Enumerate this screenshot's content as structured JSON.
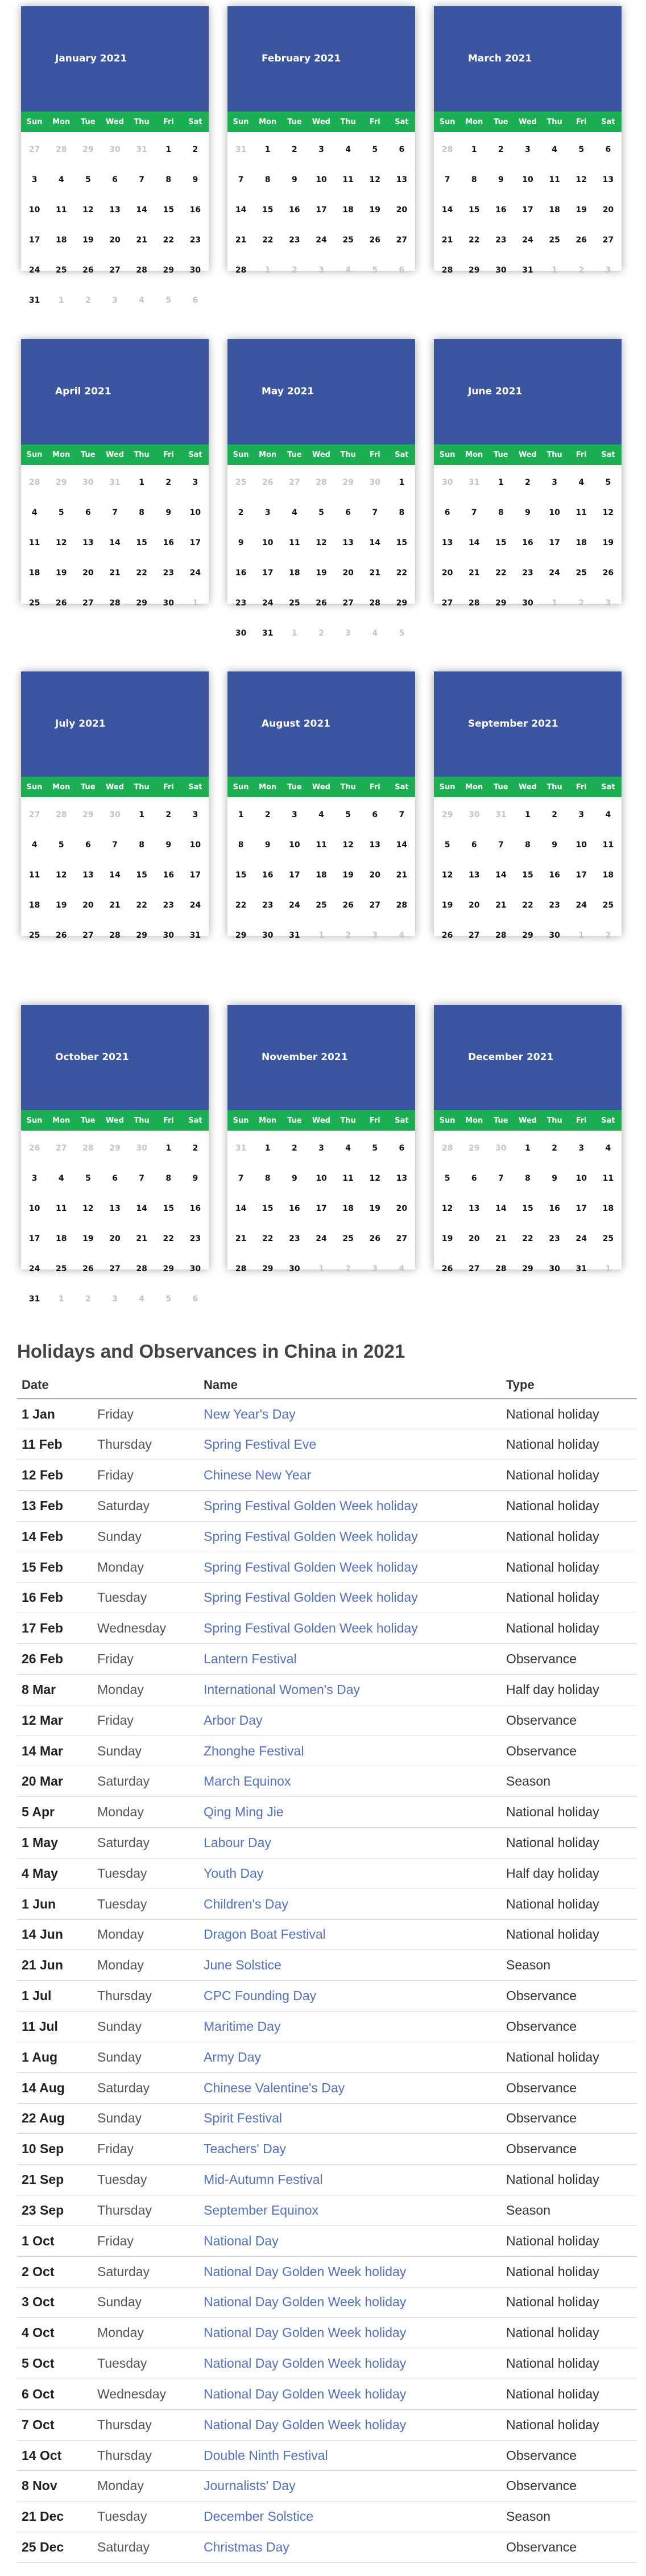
{
  "weekdays": [
    "Sun",
    "Mon",
    "Tue",
    "Wed",
    "Thu",
    "Fri",
    "Sat"
  ],
  "months": [
    {
      "title": "January 2021",
      "start": 5,
      "days": 31,
      "prev_days": 31
    },
    {
      "title": "February 2021",
      "start": 1,
      "days": 28,
      "prev_days": 31
    },
    {
      "title": "March 2021",
      "start": 1,
      "days": 31,
      "prev_days": 28
    },
    {
      "title": "April 2021",
      "start": 4,
      "days": 30,
      "prev_days": 31
    },
    {
      "title": "May 2021",
      "start": 6,
      "days": 31,
      "prev_days": 30
    },
    {
      "title": "June 2021",
      "start": 2,
      "days": 30,
      "prev_days": 31
    },
    {
      "title": "July 2021",
      "start": 4,
      "days": 31,
      "prev_days": 30
    },
    {
      "title": "August 2021",
      "start": 0,
      "days": 31,
      "prev_days": 31
    },
    {
      "title": "September 2021",
      "start": 3,
      "days": 30,
      "prev_days": 31
    },
    {
      "title": "October 2021",
      "start": 5,
      "days": 31,
      "prev_days": 30
    },
    {
      "title": "November 2021",
      "start": 1,
      "days": 30,
      "prev_days": 31
    },
    {
      "title": "December 2021",
      "start": 3,
      "days": 31,
      "prev_days": 30
    }
  ],
  "holidays": {
    "title": "Holidays and Observances in China in 2021",
    "columns": [
      "Date",
      "Name",
      "Type"
    ],
    "rows": [
      [
        "1 Jan",
        "Friday",
        "New Year's Day",
        "National holiday"
      ],
      [
        "11 Feb",
        "Thursday",
        "Spring Festival Eve",
        "National holiday"
      ],
      [
        "12 Feb",
        "Friday",
        "Chinese New Year",
        "National holiday"
      ],
      [
        "13 Feb",
        "Saturday",
        "Spring Festival Golden Week holiday",
        "National holiday"
      ],
      [
        "14 Feb",
        "Sunday",
        "Spring Festival Golden Week holiday",
        "National holiday"
      ],
      [
        "15 Feb",
        "Monday",
        "Spring Festival Golden Week holiday",
        "National holiday"
      ],
      [
        "16 Feb",
        "Tuesday",
        "Spring Festival Golden Week holiday",
        "National holiday"
      ],
      [
        "17 Feb",
        "Wednesday",
        "Spring Festival Golden Week holiday",
        "National holiday"
      ],
      [
        "26 Feb",
        "Friday",
        "Lantern Festival",
        "Observance"
      ],
      [
        "8 Mar",
        "Monday",
        "International Women's Day",
        "Half day holiday"
      ],
      [
        "12 Mar",
        "Friday",
        "Arbor Day",
        "Observance"
      ],
      [
        "14 Mar",
        "Sunday",
        "Zhonghe Festival",
        "Observance"
      ],
      [
        "20 Mar",
        "Saturday",
        "March Equinox",
        "Season"
      ],
      [
        "5 Apr",
        "Monday",
        "Qing Ming Jie",
        "National holiday"
      ],
      [
        "1 May",
        "Saturday",
        "Labour Day",
        "National holiday"
      ],
      [
        "4 May",
        "Tuesday",
        "Youth Day",
        "Half day holiday"
      ],
      [
        "1 Jun",
        "Tuesday",
        "Children's Day",
        "National holiday"
      ],
      [
        "14 Jun",
        "Monday",
        "Dragon Boat Festival",
        "National holiday"
      ],
      [
        "21 Jun",
        "Monday",
        "June Solstice",
        "Season"
      ],
      [
        "1 Jul",
        "Thursday",
        "CPC Founding Day",
        "Observance"
      ],
      [
        "11 Jul",
        "Sunday",
        "Maritime Day",
        "Observance"
      ],
      [
        "1 Aug",
        "Sunday",
        "Army Day",
        "National holiday"
      ],
      [
        "14 Aug",
        "Saturday",
        "Chinese Valentine's Day",
        "Observance"
      ],
      [
        "22 Aug",
        "Sunday",
        "Spirit Festival",
        "Observance"
      ],
      [
        "10 Sep",
        "Friday",
        "Teachers' Day",
        "Observance"
      ],
      [
        "21 Sep",
        "Tuesday",
        "Mid-Autumn Festival",
        "National holiday"
      ],
      [
        "23 Sep",
        "Thursday",
        "September Equinox",
        "Season"
      ],
      [
        "1 Oct",
        "Friday",
        "National Day",
        "National holiday"
      ],
      [
        "2 Oct",
        "Saturday",
        "National Day Golden Week holiday",
        "National holiday"
      ],
      [
        "3 Oct",
        "Sunday",
        "National Day Golden Week holiday",
        "National holiday"
      ],
      [
        "4 Oct",
        "Monday",
        "National Day Golden Week holiday",
        "National holiday"
      ],
      [
        "5 Oct",
        "Tuesday",
        "National Day Golden Week holiday",
        "National holiday"
      ],
      [
        "6 Oct",
        "Wednesday",
        "National Day Golden Week holiday",
        "National holiday"
      ],
      [
        "7 Oct",
        "Thursday",
        "National Day Golden Week holiday",
        "National holiday"
      ],
      [
        "14 Oct",
        "Thursday",
        "Double Ninth Festival",
        "Observance"
      ],
      [
        "8 Nov",
        "Monday",
        "Journalists' Day",
        "Observance"
      ],
      [
        "21 Dec",
        "Tuesday",
        "December Solstice",
        "Season"
      ],
      [
        "25 Dec",
        "Saturday",
        "Christmas Day",
        "Observance"
      ]
    ]
  },
  "colors": {
    "header_blue": "#3b55a1",
    "weekday_green": "#1cae53",
    "link_blue": "#5470c0",
    "muted_day": "#c4c4c4"
  }
}
